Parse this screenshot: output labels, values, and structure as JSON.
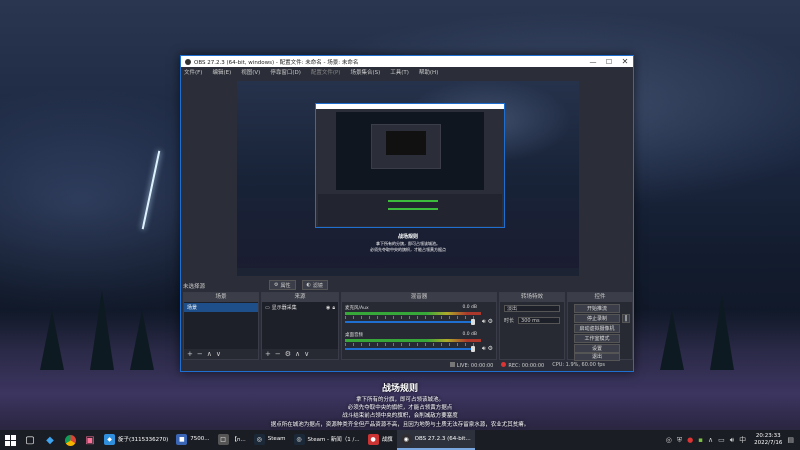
{
  "desktop": {
    "heading": "战场规则",
    "lines": [
      "拿下所有的分旗，即可占领该城池。",
      "必须先夺取中央的旗帜，才能占领黄方据点",
      "战斗结束前占领中央的旗帜，会削减敌方要塞度",
      "据点所在城池为据点，资源种类齐全但产品资源不高，且因为地势与土质无法存留泉水源，农业尤其贫瘠。"
    ]
  },
  "obs": {
    "title": "OBS 27.2.3 (64-bit, windows) - 配置文件: 未命名 - 场景: 未命名",
    "window_controls": {
      "minimize": "—",
      "maximize": "☐",
      "close": "✕"
    },
    "menu": [
      "文件(F)",
      "编辑(E)",
      "视图(V)",
      "停靠窗口(D)",
      "配置文件(P)",
      "场景集合(S)",
      "工具(T)",
      "帮助(H)"
    ],
    "preview": {
      "caption_title": "战场规则",
      "caption_lines": [
        "拿下所有的分旗，即可占领该城池。",
        "必须先夺取中央的旗帜，才能占领黄方据点"
      ]
    },
    "no_source": "未选择源",
    "filter_buttons": [
      {
        "label": "属性",
        "icon": "gear-icon"
      },
      {
        "label": "滤镜",
        "icon": "filter-icon"
      }
    ],
    "docks": {
      "scenes": {
        "title": "场景",
        "items": [
          "场景"
        ]
      },
      "sources": {
        "title": "来源",
        "items": [
          "显示器采集"
        ]
      },
      "mixer": {
        "title": "混音器",
        "channels": [
          {
            "name": "麦克风/Aux",
            "db": "0.0 dB"
          },
          {
            "name": "桌面音频",
            "db": "0.0 dB"
          }
        ]
      },
      "transitions": {
        "title": "转场特效",
        "type": "淡出",
        "duration_label": "时长",
        "duration": "300 ms"
      },
      "controls": {
        "title": "控件",
        "buttons": [
          "开始推流",
          "停止录制",
          "启动虚拟摄像机",
          "工作室模式",
          "设置",
          "退出"
        ]
      }
    },
    "status": {
      "live": "LIVE: 00:00:00",
      "rec": "REC: 00:00:00",
      "cpu": "CPU: 1.9%, 60.00 fps"
    }
  },
  "taskbar": {
    "apps": [
      {
        "label": "旋子(3115336270)",
        "icon": "qq-icon",
        "color": "#2f8fdc"
      },
      {
        "label": "7500...",
        "icon": "app-icon",
        "color": "#3a66b5"
      },
      {
        "label": "【n...",
        "icon": "browser-icon",
        "color": "#555"
      },
      {
        "label": "Steam",
        "icon": "steam-icon",
        "color": "#1b2838"
      },
      {
        "label": "Steam - 新闻（1 /...",
        "icon": "steam-icon",
        "color": "#1b2838"
      },
      {
        "label": "战旗",
        "icon": "mic-icon",
        "color": "#c33"
      },
      {
        "label": "OBS 27.2.3 (64-bit...",
        "icon": "obs-icon",
        "color": "#302e31"
      }
    ],
    "time": "20:23:33",
    "date": "2022/7/16"
  }
}
